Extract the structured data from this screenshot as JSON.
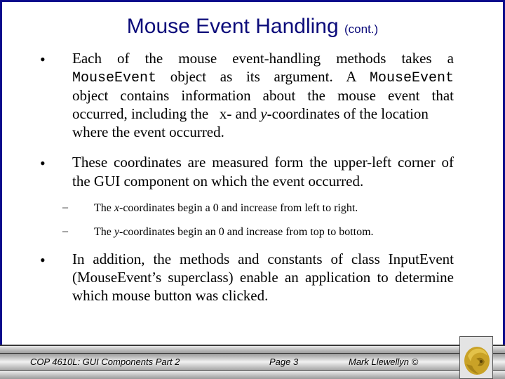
{
  "slide": {
    "title": "Mouse Event Handling",
    "title_suffix": "(cont.)",
    "bullet_glyph": "•",
    "dash_glyph": "–",
    "bullets": [
      {
        "parts": {
          "a": "Each of the mouse event-handling methods takes a",
          "b_code": "MouseEvent",
          "c": " object as its argument.  A ",
          "d_code": "MouseEvent",
          "e": "object contains information about the mouse event that",
          "f": "occurred, including the   x- and ",
          "g_ital": "y",
          "h": "-coordinates of the location",
          "i": "where the event occurred."
        }
      },
      {
        "line1": "These coordinates are measured form the upper-left corner of",
        "line2": "the GUI component on which the event occurred.",
        "subitems": [
          {
            "pre": "The ",
            "ital": "x",
            "post": "-coordinates begin a 0 and increase from left to right."
          },
          {
            "pre": "The ",
            "ital": "y",
            "post": "-coordinates begin an 0 and increase from top to bottom."
          }
        ]
      },
      {
        "line1": "In addition, the methods and constants of class InputEvent",
        "line2": "(MouseEvent’s superclass) enable an application to determine",
        "line3": "which mouse button was clicked."
      }
    ]
  },
  "footer": {
    "course": "COP 4610L: GUI Components Part 2",
    "page": "Page 3",
    "author": "Mark Llewellyn ©",
    "logo": "pegasus-logo"
  },
  "colors": {
    "border": "#0a0a8c",
    "title": "#0b0b7a",
    "logo_gold": "#c9a227"
  }
}
